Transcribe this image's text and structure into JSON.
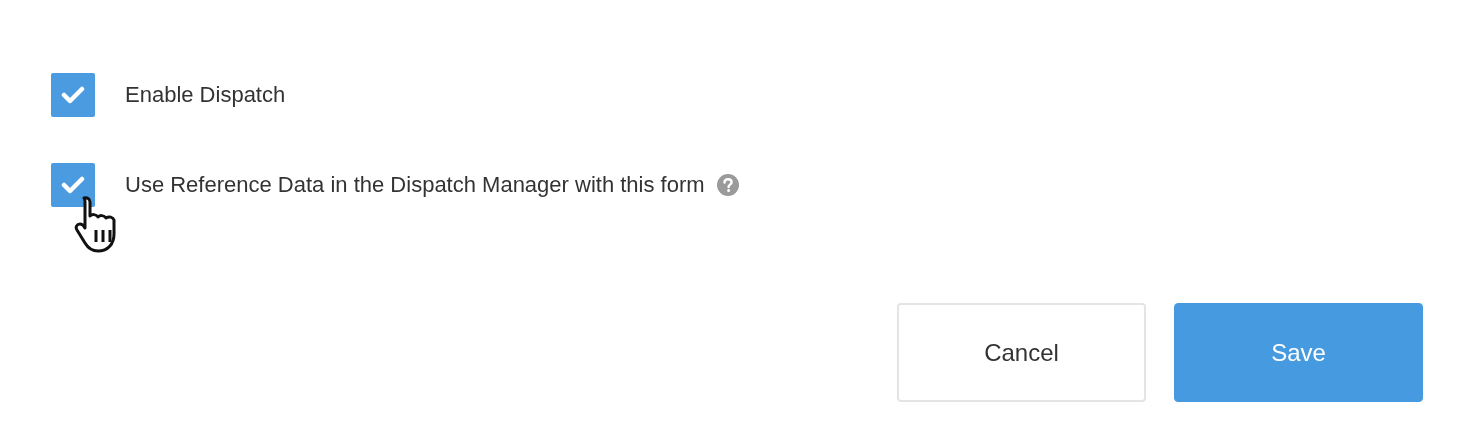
{
  "options": [
    {
      "label": "Enable Dispatch",
      "checked": true,
      "help": false
    },
    {
      "label": "Use Reference Data in the Dispatch Manager with this form",
      "checked": true,
      "help": true
    }
  ],
  "buttons": [
    {
      "label": "Cancel",
      "kind": "secondary"
    },
    {
      "label": "Save",
      "kind": "primary"
    }
  ]
}
